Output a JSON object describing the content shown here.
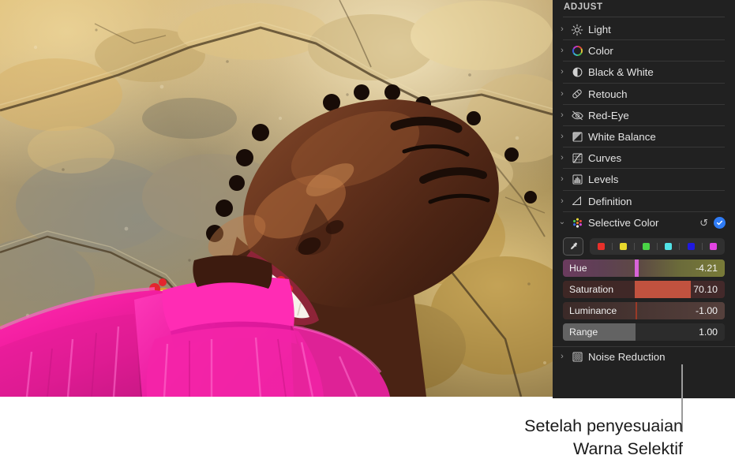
{
  "panel": {
    "title": "ADJUST",
    "rows": [
      {
        "label": "Light",
        "icon": "sun-icon",
        "disclosure": "collapsed"
      },
      {
        "label": "Color",
        "icon": "color-wheel-icon",
        "disclosure": "collapsed"
      },
      {
        "label": "Black & White",
        "icon": "half-circle-icon",
        "disclosure": "collapsed"
      },
      {
        "label": "Retouch",
        "icon": "bandage-icon",
        "disclosure": "collapsed"
      },
      {
        "label": "Red-Eye",
        "icon": "eye-slash-icon",
        "disclosure": "collapsed"
      },
      {
        "label": "White Balance",
        "icon": "white-balance-icon",
        "disclosure": "collapsed"
      },
      {
        "label": "Curves",
        "icon": "curves-icon",
        "disclosure": "collapsed"
      },
      {
        "label": "Levels",
        "icon": "levels-icon",
        "disclosure": "collapsed"
      },
      {
        "label": "Definition",
        "icon": "definition-icon",
        "disclosure": "collapsed"
      },
      {
        "label": "Selective Color",
        "icon": "selective-color-icon",
        "disclosure": "expanded"
      },
      {
        "label": "Noise Reduction",
        "icon": "noise-reduction-icon",
        "disclosure": "collapsed"
      }
    ],
    "selective_color": {
      "reset_icon": "reset-arrow-icon",
      "enabled_icon": "checkmark-icon",
      "enabled_color": "#2f7cf6",
      "eyedropper_icon": "eyedropper-icon",
      "swatches": [
        {
          "name": "red-swatch",
          "color": "#e8302a"
        },
        {
          "name": "yellow-swatch",
          "color": "#e9d92c"
        },
        {
          "name": "green-swatch",
          "color": "#4ad446"
        },
        {
          "name": "cyan-swatch",
          "color": "#51e2e6"
        },
        {
          "name": "blue-swatch",
          "color": "#2019e0"
        },
        {
          "name": "magenta-swatch",
          "color": "#e244e2"
        }
      ],
      "sliders": [
        {
          "name": "Hue",
          "value": "-4.21",
          "track_gradient": "linear-gradient(90deg,#6b3b5e 0%,#5f3f55 22%,#5d4a43 48%,#6b6b3a 72%,#787a38 100%)",
          "fill_percent": 0,
          "fill_color": "transparent",
          "thumb_percent": 45.5,
          "thumb_color": "#d864d8",
          "thumb_width": 5
        },
        {
          "name": "Saturation",
          "value": "70.10",
          "track_gradient": "linear-gradient(90deg,#3e2725 0%,#43292a 100%)",
          "fill_percent": 0,
          "fill_color": "transparent",
          "bar_start": 45.5,
          "bar_end": 79.0,
          "bar_color": "#c1523f",
          "thumb_percent": -1,
          "thumb_color": "#c1523f",
          "thumb_width": 0
        },
        {
          "name": "Luminance",
          "value": "-1.00",
          "track_gradient": "linear-gradient(90deg,#3b2a28 0%,#4a3734 55%,#55403c 100%)",
          "fill_percent": 0,
          "fill_color": "transparent",
          "thumb_percent": 45.5,
          "thumb_color": "#9a3a27",
          "thumb_width": 2
        },
        {
          "name": "Range",
          "value": "1.00",
          "track_gradient": "linear-gradient(90deg,#2c2c2c 0%,#2c2c2c 100%)",
          "fill_percent": 45.5,
          "fill_color": "#636363",
          "thumb_percent": -1,
          "thumb_color": "#636363",
          "thumb_width": 0
        }
      ]
    }
  },
  "callout": {
    "line1": "Setelah penyesuaian",
    "line2": "Warna Selektif"
  },
  "photo": {
    "alt": "Woman with braided hair lying on golden rock wearing a magenta sheer top"
  }
}
